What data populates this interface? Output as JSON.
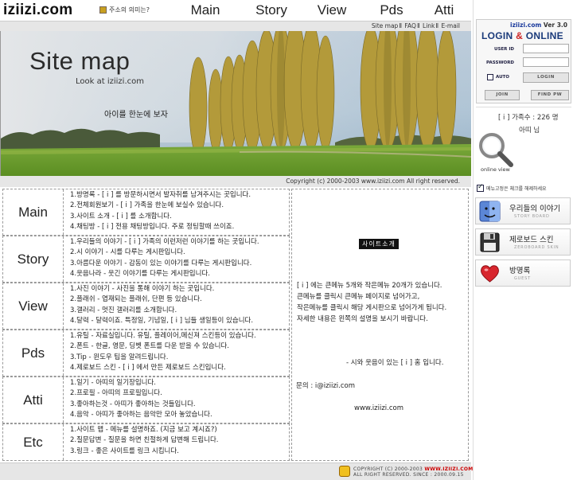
{
  "header": {
    "logo": "iziizi.com",
    "meaning_link": "주소의 의미는?",
    "nav": [
      "Main",
      "Story",
      "View",
      "Pds",
      "Atti"
    ]
  },
  "sublinks": [
    "Site map",
    "FAQ",
    "Link",
    "E-mail"
  ],
  "hero": {
    "title": "Site map",
    "subtitle": "Look at iziizi.com",
    "tagline": "아이를 한눈에 보자"
  },
  "copyright": "Copyright (c) 2000-2003 www.iziizi.com All right reserved.",
  "sections": [
    {
      "title": "Main",
      "items": [
        "1.방명록 - [ i ] 를 방문하시면서 발자취를 남겨주시는 곳입니다.",
        "2.전체회원보기 - [ i ] 가족을 한눈에 보실수 있습니다.",
        "3.사이트 소개 - [ i ] 를 소개합니다.",
        "4.채팅방 - [ i ] 전용 채팅방입니다. 주로 정팅할때 쓰이죠."
      ]
    },
    {
      "title": "Story",
      "items": [
        "1.우리들의 이야기 - [ i ] 가족의 이런저런 이야기를 하는 곳입니다.",
        "2.시 이야기 - 시를 다루는 게시판입니다.",
        "3.아름다운 이야기 - 감동이 있는 이야기를 다루는 게시판입니다.",
        "4.웃음나라 - 웃긴 이야기를 다루는 게시판입니다."
      ]
    },
    {
      "title": "View",
      "items": [
        "1.사진 이야기 - 사진을 통해 이야기 하는 곳입니다.",
        "2.플래쉬 - 엽재되는 플래쉬, 단편 등 있습니다.",
        "3.갤러리 - 멋진 갤러리를 소개합니다.",
        "4.달력 - 달력이죠. 특정일, 기념일, [ i ] 님들 생일등이 있습니다."
      ]
    },
    {
      "title": "Pds",
      "items": [
        "1.유틸 - 자료실입니다. 유틸, 플레이어,메신져 스킨등이 있습니다.",
        "2.폰트 - 한글, 영문, 딩벳 폰트를 다운 받을 수 있습니다.",
        "3.Tip - 윈도우 팁을 알려드립니다.",
        "4.제로보드 스킨 - [ i ] 에서 만든 제로보드 스킨입니다."
      ]
    },
    {
      "title": "Atti",
      "items": [
        "1.일기 - 아띠의 일기장입니다.",
        "2.프로필 - 아띠의 프로필입니다.",
        "3.좋아하는것 - 아띠가 좋아하는 것들입니다.",
        "4.음악 - 아띠가 좋아하는 음악만 모아 놓았습니다."
      ]
    },
    {
      "title": "Etc",
      "items": [
        "1.사이트 맵 - 메뉴를 설명하죠. (지금 보고 계시죠?)",
        "2.질문답변 - 질문을 하면 친절하게 답변해 드립니다.",
        "3.링크 - 좋은 사이트를 링크 시킵니다."
      ]
    }
  ],
  "about": {
    "badge": "사이트소개",
    "lines": [
      "[ i ] 에는 큰메뉴 5개와 작은메뉴 20개가 있습니다.",
      "큰메뉴를 클릭시 큰메뉴 페이지로 넘어가고,",
      "작은메뉴를 클릭시 해당 게시판으로 넘어가게 됩니다.",
      "자세한 내용은 왼쪽의 설명을 보시기 바랍니다."
    ],
    "signature": "- 시와 웃음이 있는 [ i ] 홈 입니다.",
    "contact": "문의 : i@iziizi.com",
    "url": "www.iziizi.com"
  },
  "footer": {
    "line1_prefix": "COPYRIGHT (C) 2000-2003",
    "line1_site": "WWW.IZIIZI.COM",
    "line2": "ALL RIGHT RESERVED. SINCE : 2000.09.15"
  },
  "login": {
    "brand": "iziizi.com",
    "version": "Ver 3.0",
    "title_a": "LOGIN",
    "title_amp": "&",
    "title_b": "ONLINE",
    "user_id_label": "USER ID",
    "password_label": "PASSWORD",
    "auto_label": "AUTO",
    "login_button": "LOGIN",
    "join_button": "JOIN",
    "find_pw_button": "FIND PW"
  },
  "online": {
    "count_text": "[ i ] 가족수 : 226 명",
    "user_text": "아띠 님",
    "view_label": "online view"
  },
  "agree_text": "메뉴고정은 체크를 해제하세요",
  "side_menu": [
    {
      "title": "우리들의 이야기",
      "sub": "STORY BOARD",
      "icon": "finder-icon"
    },
    {
      "title": "제로보드 스킨",
      "sub": "ZEROBOARD SKIN",
      "icon": "floppy-icon"
    },
    {
      "title": "방명록",
      "sub": "GUEST",
      "icon": "heart-icon"
    }
  ],
  "colors": {
    "accent_blue": "#1a3a7a",
    "accent_red": "#cc2222",
    "bar_gray": "#e6e6e6"
  }
}
